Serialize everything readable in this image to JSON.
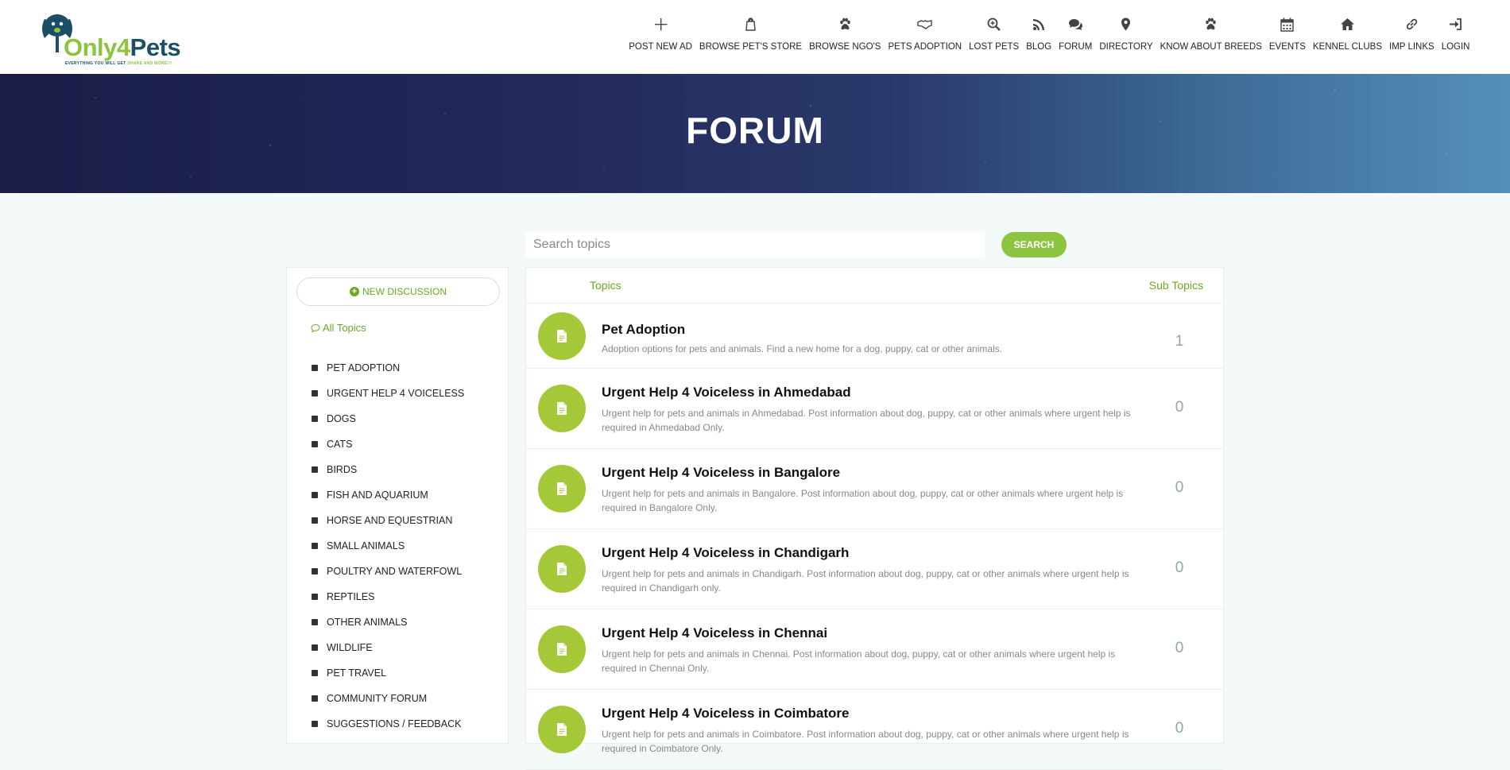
{
  "brand": {
    "name_only": "Only",
    "name_4": "4",
    "name_pets": "Pets",
    "tagline_a": "EVERYTHING YOU WILL GET ",
    "tagline_b": "SHARE AND MORE!!!"
  },
  "nav": [
    {
      "label": "POST NEW AD",
      "icon": "plus-icon"
    },
    {
      "label": "BROWSE PET'S STORE",
      "icon": "shopping-bag-icon"
    },
    {
      "label": "BROWSE NGO'S",
      "icon": "paw-icon"
    },
    {
      "label": "PETS ADOPTION",
      "icon": "handshake-icon"
    },
    {
      "label": "LOST PETS",
      "icon": "search-plus-icon"
    },
    {
      "label": "BLOG",
      "icon": "rss-icon"
    },
    {
      "label": "FORUM",
      "icon": "comments-icon"
    },
    {
      "label": "DIRECTORY",
      "icon": "map-marker-icon"
    },
    {
      "label": "KNOW ABOUT BREEDS",
      "icon": "paw-icon"
    },
    {
      "label": "EVENTS",
      "icon": "calendar-icon"
    },
    {
      "label": "KENNEL CLUBS",
      "icon": "home-icon"
    },
    {
      "label": "IMP LINKS",
      "icon": "link-icon"
    },
    {
      "label": "LOGIN",
      "icon": "sign-in-icon"
    }
  ],
  "banner": {
    "title": "FORUM"
  },
  "search": {
    "placeholder": "Search topics",
    "button_label": "SEARCH"
  },
  "sidebar": {
    "new_discussion_label": "NEW DISCUSSION",
    "all_topics_label": "All Topics",
    "categories": [
      "PET ADOPTION",
      "URGENT HELP 4 VOICELESS",
      "DOGS",
      "CATS",
      "BIRDS",
      "FISH AND AQUARIUM",
      "HORSE AND EQUESTRIAN",
      "SMALL ANIMALS",
      "POULTRY AND WATERFOWL",
      "REPTILES",
      "OTHER ANIMALS",
      "WILDLIFE",
      "PET TRAVEL",
      "COMMUNITY FORUM",
      "SUGGESTIONS / FEEDBACK"
    ]
  },
  "topics": {
    "header_topics": "Topics",
    "header_sub": "Sub Topics",
    "rows": [
      {
        "title": "Pet Adoption",
        "desc": "Adoption options for pets and animals. Find a new home for a dog, puppy, cat or other animals.",
        "count": "1"
      },
      {
        "title": "Urgent Help 4 Voiceless in Ahmedabad",
        "desc": "Urgent help for pets and animals in Ahmedabad. Post information about dog, puppy, cat or other animals where urgent help is required in Ahmedabad Only.",
        "count": "0"
      },
      {
        "title": "Urgent Help 4 Voiceless in Bangalore",
        "desc": "Urgent help for pets and animals in Bangalore. Post information about dog, puppy, cat or other animals where urgent help is required in Bangalore Only.",
        "count": "0"
      },
      {
        "title": "Urgent Help 4 Voiceless in Chandigarh",
        "desc": "Urgent help for pets and animals in Chandigarh. Post information about dog, puppy, cat or other animals where urgent help is required in Chandigarh only.",
        "count": "0"
      },
      {
        "title": "Urgent Help 4 Voiceless in Chennai",
        "desc": "Urgent help for pets and animals in Chennai. Post information about dog, puppy, cat or other animals where urgent help is required in Chennai Only.",
        "count": "0"
      },
      {
        "title": "Urgent Help 4 Voiceless in Coimbatore",
        "desc": "Urgent help for pets and animals in Coimbatore. Post information about dog, puppy, cat or other animals where urgent help is required in Coimbatore Only.",
        "count": "0"
      }
    ]
  },
  "colors": {
    "accent": "#8cc43f",
    "topic_icon": "#a5c838",
    "brand_dark": "#1a4f66"
  }
}
